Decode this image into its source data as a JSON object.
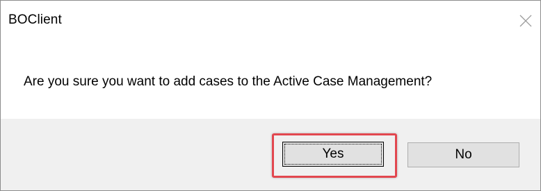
{
  "window": {
    "title": "BOClient",
    "close_icon": "close-icon"
  },
  "dialog": {
    "message": "Are you sure you want to add cases to the Active Case Management?"
  },
  "buttons": {
    "yes_label": "Yes",
    "no_label": "No"
  },
  "colors": {
    "highlight": "#e2474f",
    "footer_background": "#f0f0f0",
    "button_background": "#e1e1e1"
  }
}
